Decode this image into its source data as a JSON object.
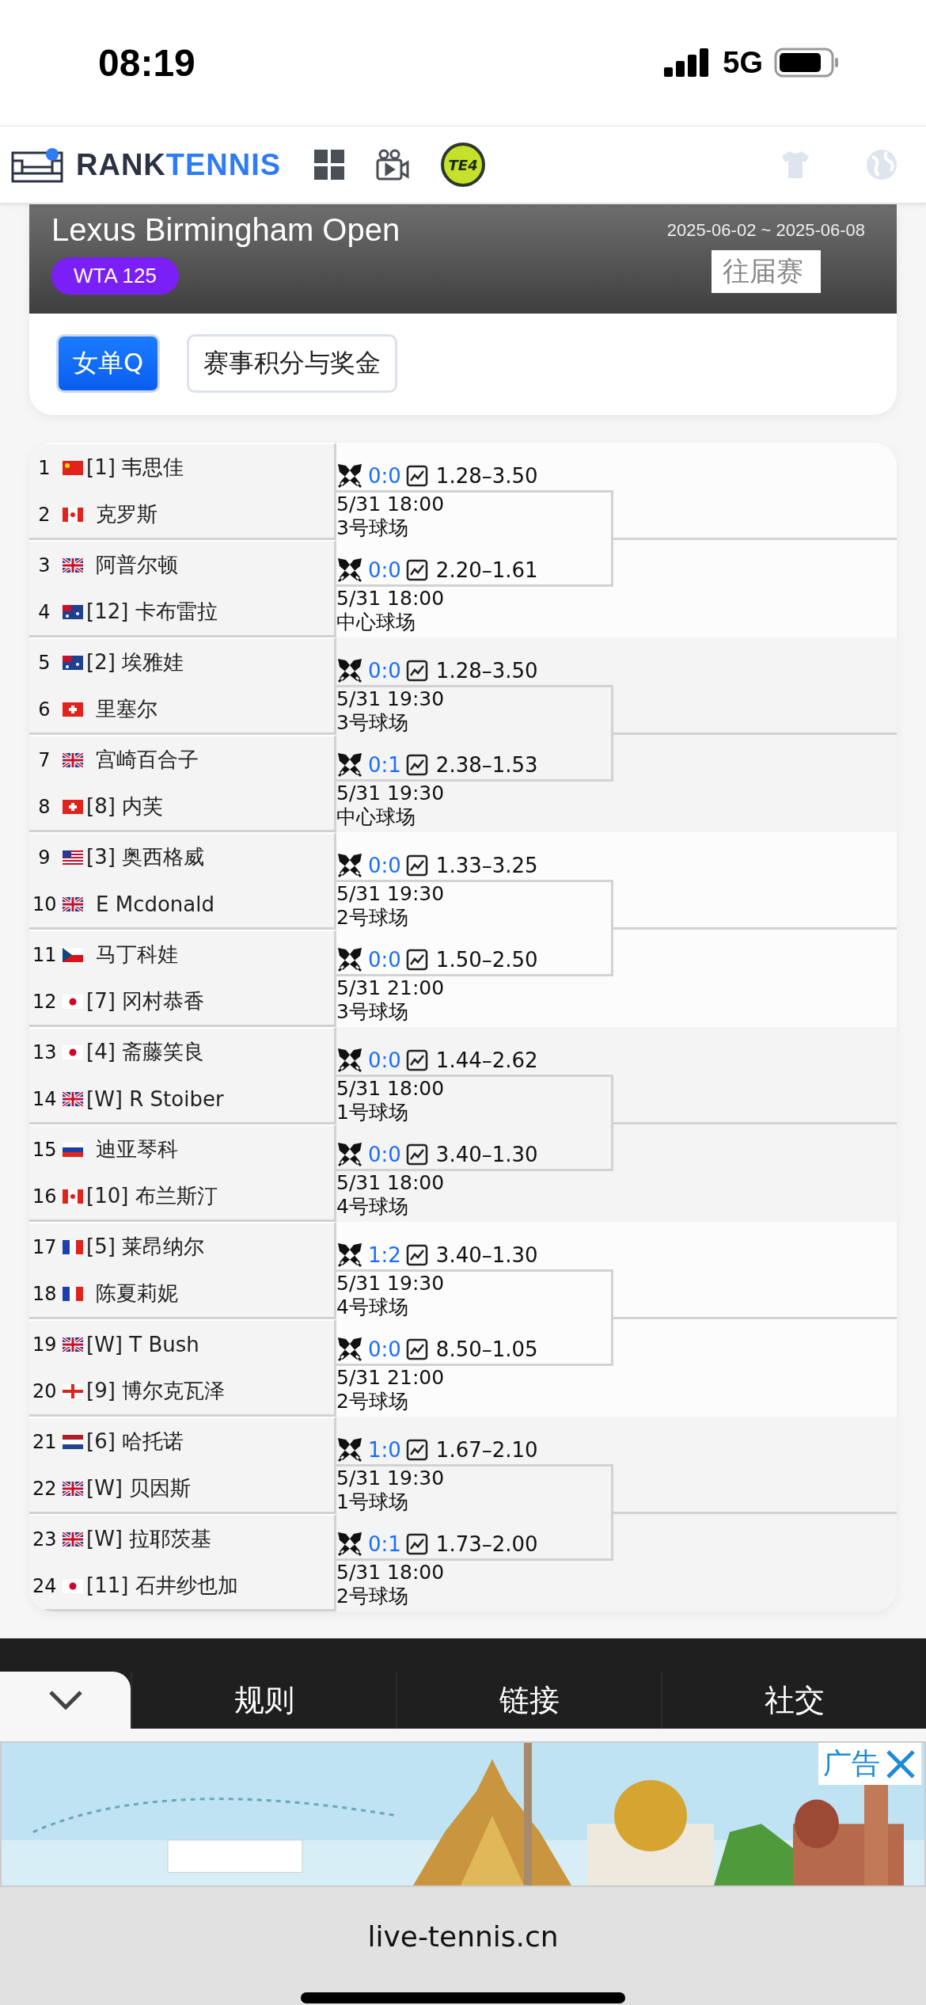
{
  "status_bar": {
    "time": "08:19",
    "network": "5G"
  },
  "nav": {
    "brand_a": "RANK",
    "brand_b": "TENNIS",
    "badge_logo": "TE4"
  },
  "tournament": {
    "title": "Lexus Birmingham Open",
    "level": "WTA 125",
    "dates": "2025-06-02 ~ 2025-06-08",
    "past_button": "往届赛"
  },
  "tabs": [
    {
      "label": "女单Q",
      "selected": true
    },
    {
      "label": "赛事积分与奖金",
      "selected": false
    }
  ],
  "groups": [
    {
      "matches": [
        {
          "players": [
            {
              "no": "1",
              "kind": "cn",
              "seed": "[1]",
              "name": "韦思佳"
            },
            {
              "no": "2",
              "kind": "ca",
              "name": "克罗斯"
            }
          ],
          "score": "0:0",
          "odds": "1.28–3.50",
          "time": "5/31 18:00",
          "court": "3号球场"
        },
        {
          "players": [
            {
              "no": "3",
              "kind": "gb",
              "name": "阿普尔顿"
            },
            {
              "no": "4",
              "kind": "au",
              "seed": "[12]",
              "name": "卡布雷拉"
            }
          ],
          "score": "0:0",
          "odds": "2.20–1.61",
          "time": "5/31 18:00",
          "court": "中心球场"
        }
      ]
    },
    {
      "matches": [
        {
          "players": [
            {
              "no": "5",
              "kind": "au",
              "seed": "[2]",
              "name": "埃雅娃"
            },
            {
              "no": "6",
              "kind": "ch",
              "name": "里塞尔"
            }
          ],
          "score": "0:0",
          "odds": "1.28–3.50",
          "time": "5/31 19:30",
          "court": "3号球场"
        },
        {
          "players": [
            {
              "no": "7",
              "kind": "gb",
              "name": "宫崎百合子"
            },
            {
              "no": "8",
              "kind": "ch",
              "seed": "[8]",
              "name": "内芙"
            }
          ],
          "score": "0:1",
          "odds": "2.38–1.53",
          "time": "5/31 19:30",
          "court": "中心球场"
        }
      ]
    },
    {
      "matches": [
        {
          "players": [
            {
              "no": "9",
              "kind": "us",
              "seed": "[3]",
              "name": "奥西格威"
            },
            {
              "no": "10",
              "kind": "gb",
              "name": "E Mcdonald"
            }
          ],
          "score": "0:0",
          "odds": "1.33–3.25",
          "time": "5/31 19:30",
          "court": "2号球场"
        },
        {
          "players": [
            {
              "no": "11",
              "kind": "cz",
              "name": "马丁科娃"
            },
            {
              "no": "12",
              "kind": "jp",
              "seed": "[7]",
              "name": "冈村恭香"
            }
          ],
          "score": "0:0",
          "odds": "1.50–2.50",
          "time": "5/31 21:00",
          "court": "3号球场"
        }
      ]
    },
    {
      "matches": [
        {
          "players": [
            {
              "no": "13",
              "kind": "jp",
              "seed": "[4]",
              "name": "斋藤笑良"
            },
            {
              "no": "14",
              "kind": "gb",
              "seed": "[W]",
              "name": "R Stoiber"
            }
          ],
          "score": "0:0",
          "odds": "1.44–2.62",
          "time": "5/31 18:00",
          "court": "1号球场"
        },
        {
          "players": [
            {
              "no": "15",
              "kind": "ru",
              "name": "迪亚琴科"
            },
            {
              "no": "16",
              "kind": "ca",
              "seed": "[10]",
              "name": "布兰斯汀"
            }
          ],
          "score": "0:0",
          "odds": "3.40–1.30",
          "time": "5/31 18:00",
          "court": "4号球场"
        }
      ]
    },
    {
      "matches": [
        {
          "players": [
            {
              "no": "17",
              "kind": "fr",
              "seed": "[5]",
              "name": "莱昂纳尔"
            },
            {
              "no": "18",
              "kind": "fr",
              "name": "陈夏莉妮"
            }
          ],
          "score": "1:2",
          "odds": "3.40–1.30",
          "time": "5/31 19:30",
          "court": "4号球场"
        },
        {
          "players": [
            {
              "no": "19",
              "kind": "gb",
              "seed": "[W]",
              "name": "T Bush"
            },
            {
              "no": "20",
              "kind": "ge",
              "seed": "[9]",
              "name": "博尔克瓦泽"
            }
          ],
          "score": "0:0",
          "odds": "8.50–1.05",
          "time": "5/31 21:00",
          "court": "2号球场"
        }
      ]
    },
    {
      "matches": [
        {
          "players": [
            {
              "no": "21",
              "kind": "nl",
              "seed": "[6]",
              "name": "哈托诺"
            },
            {
              "no": "22",
              "kind": "gb",
              "seed": "[W]",
              "name": "贝因斯"
            }
          ],
          "score": "1:0",
          "odds": "1.67–2.10",
          "time": "5/31 19:30",
          "court": "1号球场"
        },
        {
          "players": [
            {
              "no": "23",
              "kind": "gb",
              "seed": "[W]",
              "name": "拉耶茨基"
            },
            {
              "no": "24",
              "kind": "jp",
              "seed": "[11]",
              "name": "石井纱也加"
            }
          ],
          "score": "0:1",
          "odds": "1.73–2.00",
          "time": "5/31 18:00",
          "court": "2号球场"
        }
      ]
    }
  ],
  "footer_tabs": [
    "规则",
    "链接",
    "社交"
  ],
  "ad": {
    "kind": "picture",
    "label": "广告"
  },
  "browser": {
    "url": "live-tennis.cn"
  }
}
